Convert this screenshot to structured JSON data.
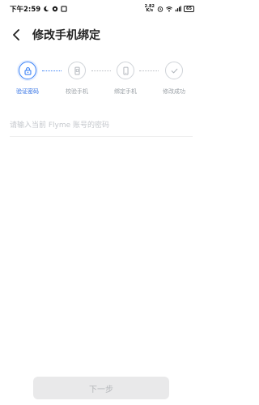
{
  "status_bar": {
    "time": "下午2:59",
    "speed_top": "2.82",
    "speed_bottom": "K/s",
    "battery": "65"
  },
  "header": {
    "title": "修改手机绑定"
  },
  "steps": [
    {
      "label": "验证密码",
      "icon": "lock-icon",
      "active": true
    },
    {
      "label": "校验手机",
      "icon": "phone-check-icon",
      "active": false
    },
    {
      "label": "绑定手机",
      "icon": "phone-icon",
      "active": false
    },
    {
      "label": "修改成功",
      "icon": "check-icon",
      "active": false
    }
  ],
  "form": {
    "password_placeholder": "请输入当前 Flyme 账号的密码",
    "password_value": ""
  },
  "next_button": "下一步",
  "colors": {
    "accent": "#3b82f6",
    "inactive": "#cfd3d8",
    "button_bg": "#e9e9ea",
    "button_text": "#b4b6ba"
  }
}
